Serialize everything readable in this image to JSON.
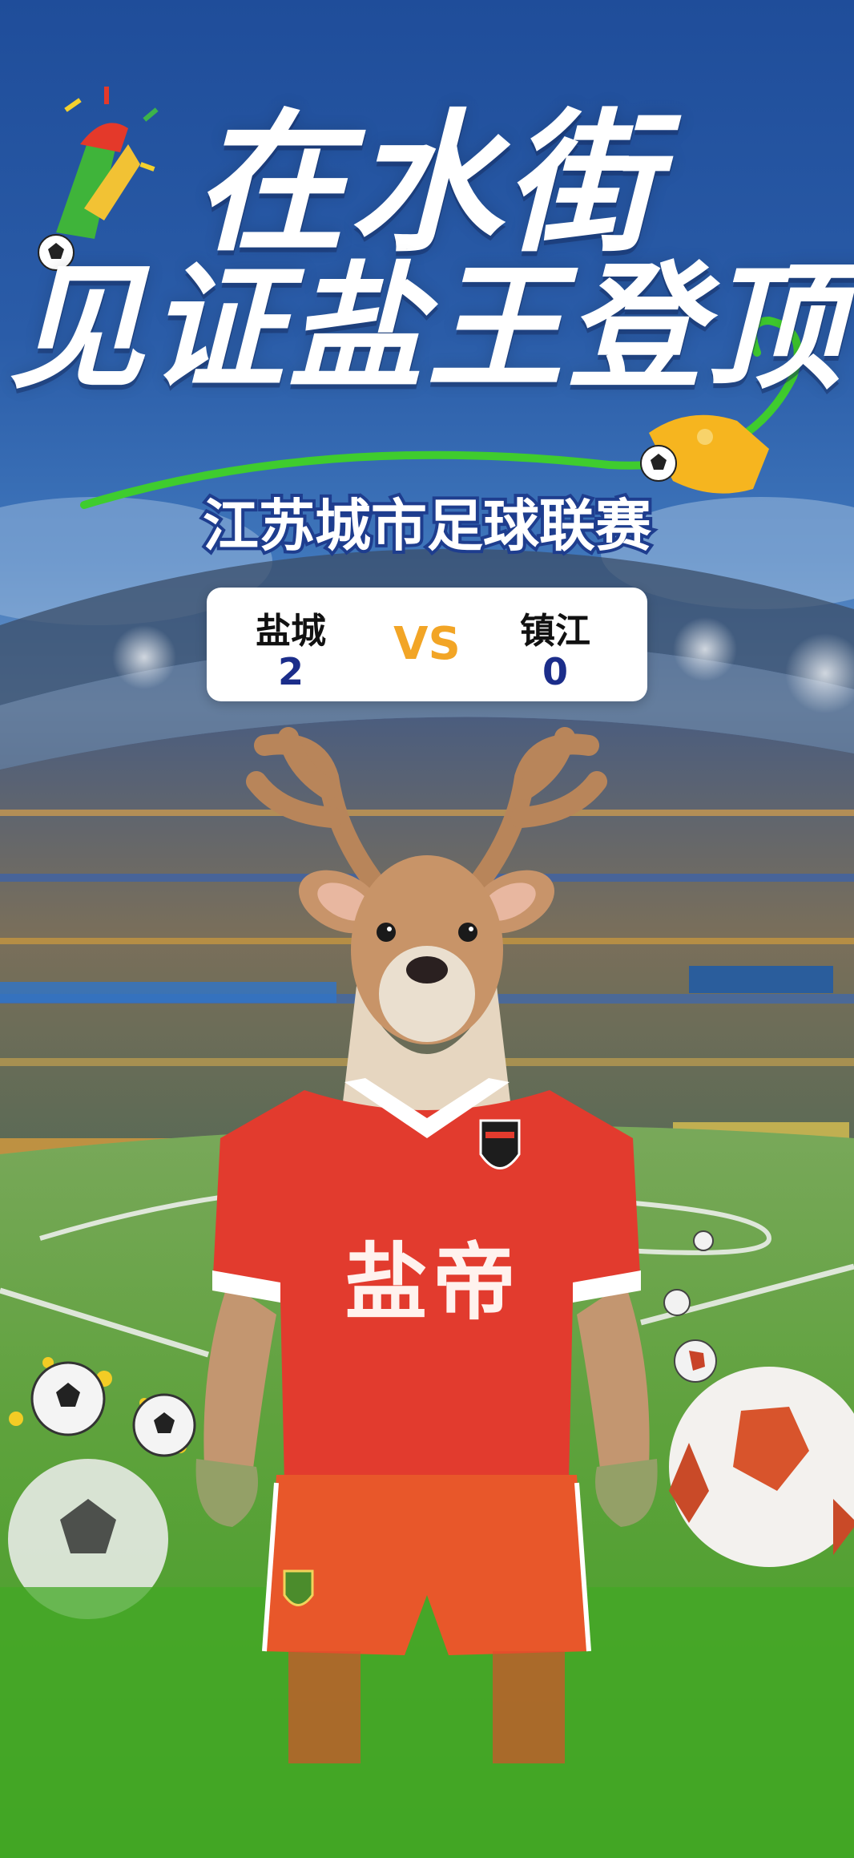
{
  "header": {
    "title_line1": "在水街",
    "title_line2": "见证盐王登顶",
    "subtitle": "江苏城市足球联赛"
  },
  "match": {
    "home_team": "盐城",
    "home_score": "2",
    "vs_label": "VS",
    "away_team": "镇江",
    "away_score": "0"
  },
  "mascot": {
    "jersey_text": "盐帝"
  },
  "colors": {
    "sky_top": "#1f4d9a",
    "pitch_green": "#3e9f22",
    "jersey_red": "#e23b2e",
    "score_blue": "#1b2d8a",
    "vs_orange": "#f2a526"
  },
  "icons": [
    "soccer-ball-icon",
    "horn-icon",
    "whistle-icon"
  ]
}
